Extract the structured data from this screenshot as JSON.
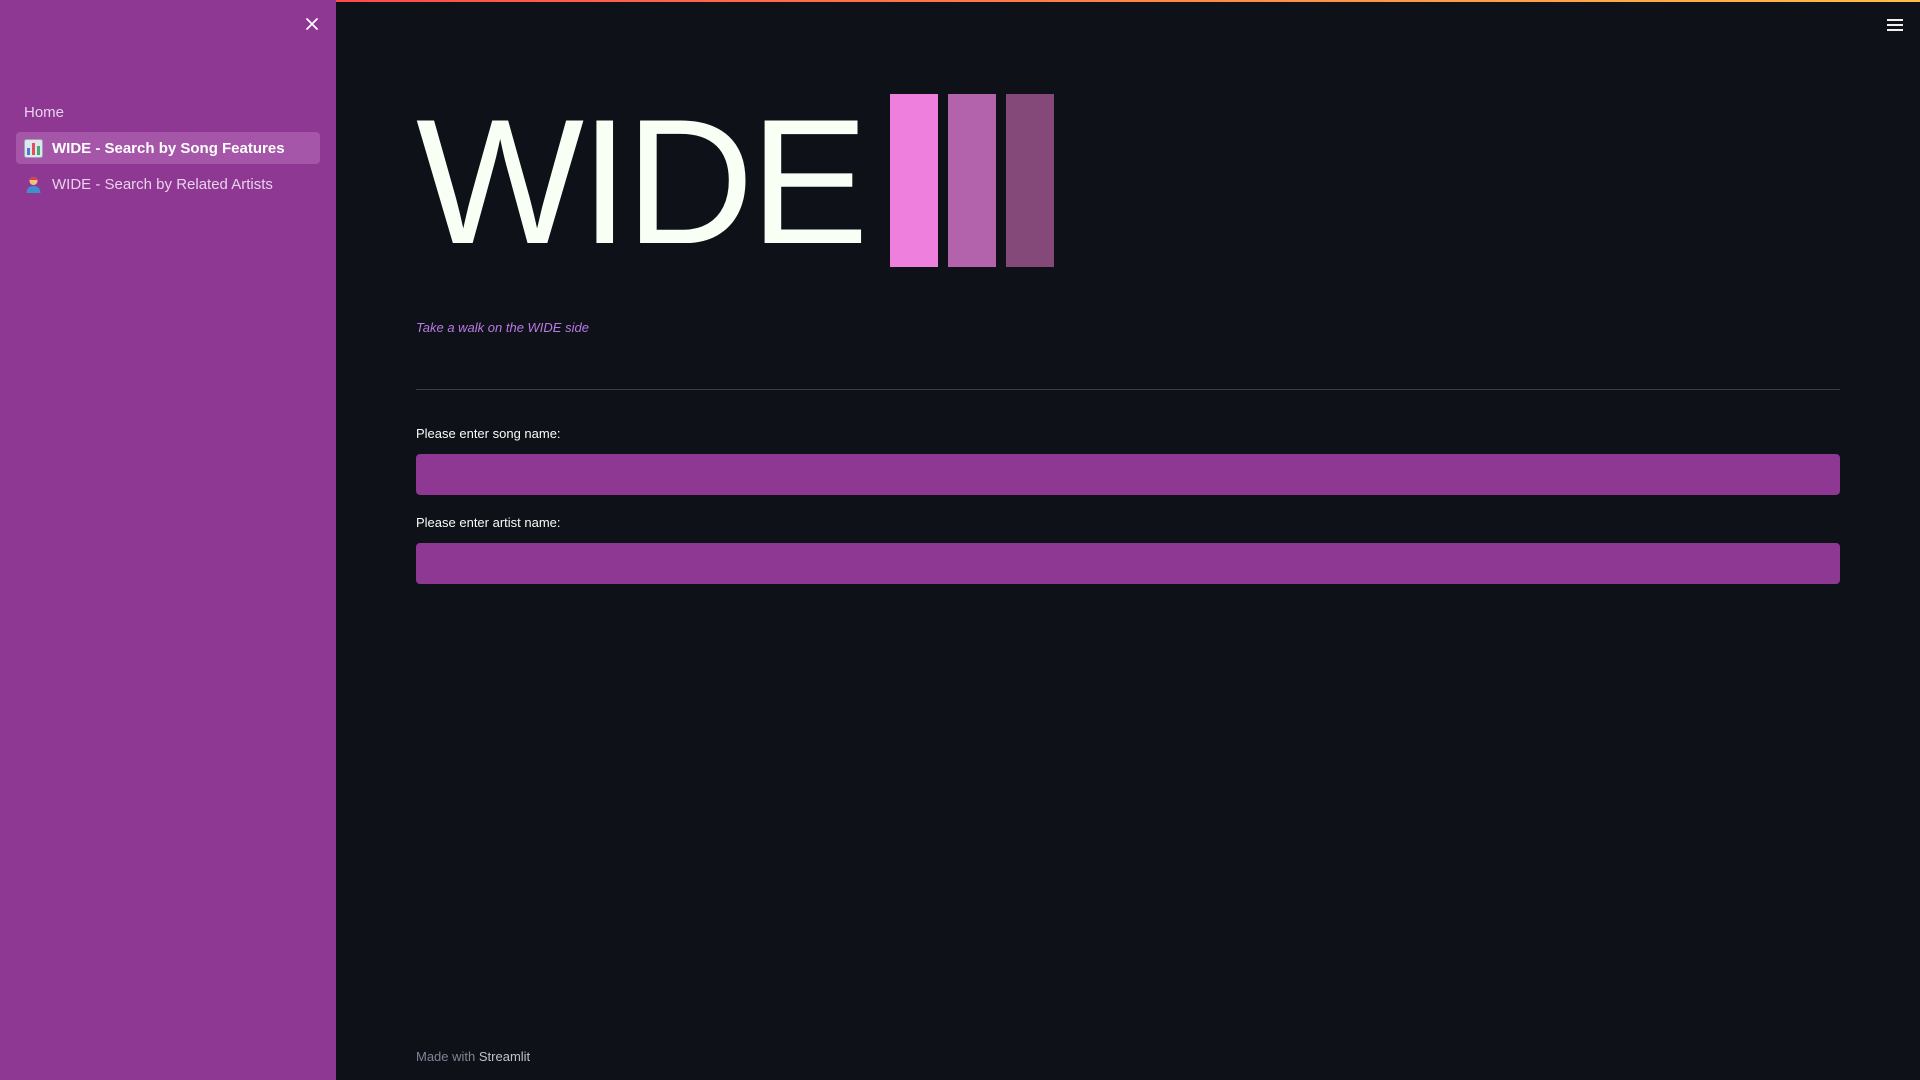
{
  "sidebar": {
    "items": [
      {
        "label": "Home",
        "icon": ""
      },
      {
        "label": "WIDE - Search by Song Features",
        "icon": "bar-chart-icon"
      },
      {
        "label": "WIDE - Search by Related Artists",
        "icon": "person-icon"
      }
    ],
    "active_index": 1
  },
  "header": {
    "logo_text": "WIDE",
    "logo_bar_colors": [
      "#ef7fdc",
      "#b363ab",
      "#844979"
    ]
  },
  "main": {
    "tagline": "Take a walk on the WIDE side",
    "song_field": {
      "label": "Please enter song name:",
      "value": "",
      "placeholder": ""
    },
    "artist_field": {
      "label": "Please enter artist name:",
      "value": "",
      "placeholder": ""
    }
  },
  "footer": {
    "prefix": "Made with",
    "brand": "Streamlit"
  },
  "colors": {
    "sidebar_bg": "#8e3893",
    "app_bg": "#0e1117",
    "accent": "#b77be3",
    "input_bg": "#8e3893"
  }
}
